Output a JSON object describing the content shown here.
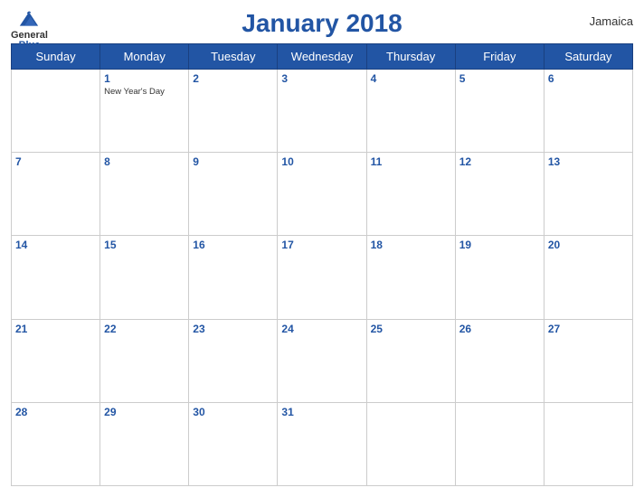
{
  "header": {
    "title": "January 2018",
    "country": "Jamaica",
    "logo": {
      "line1": "General",
      "line2": "Blue"
    }
  },
  "days_of_week": [
    "Sunday",
    "Monday",
    "Tuesday",
    "Wednesday",
    "Thursday",
    "Friday",
    "Saturday"
  ],
  "weeks": [
    [
      {
        "day": "",
        "holiday": ""
      },
      {
        "day": "1",
        "holiday": "New Year's Day"
      },
      {
        "day": "2",
        "holiday": ""
      },
      {
        "day": "3",
        "holiday": ""
      },
      {
        "day": "4",
        "holiday": ""
      },
      {
        "day": "5",
        "holiday": ""
      },
      {
        "day": "6",
        "holiday": ""
      }
    ],
    [
      {
        "day": "7",
        "holiday": ""
      },
      {
        "day": "8",
        "holiday": ""
      },
      {
        "day": "9",
        "holiday": ""
      },
      {
        "day": "10",
        "holiday": ""
      },
      {
        "day": "11",
        "holiday": ""
      },
      {
        "day": "12",
        "holiday": ""
      },
      {
        "day": "13",
        "holiday": ""
      }
    ],
    [
      {
        "day": "14",
        "holiday": ""
      },
      {
        "day": "15",
        "holiday": ""
      },
      {
        "day": "16",
        "holiday": ""
      },
      {
        "day": "17",
        "holiday": ""
      },
      {
        "day": "18",
        "holiday": ""
      },
      {
        "day": "19",
        "holiday": ""
      },
      {
        "day": "20",
        "holiday": ""
      }
    ],
    [
      {
        "day": "21",
        "holiday": ""
      },
      {
        "day": "22",
        "holiday": ""
      },
      {
        "day": "23",
        "holiday": ""
      },
      {
        "day": "24",
        "holiday": ""
      },
      {
        "day": "25",
        "holiday": ""
      },
      {
        "day": "26",
        "holiday": ""
      },
      {
        "day": "27",
        "holiday": ""
      }
    ],
    [
      {
        "day": "28",
        "holiday": ""
      },
      {
        "day": "29",
        "holiday": ""
      },
      {
        "day": "30",
        "holiday": ""
      },
      {
        "day": "31",
        "holiday": ""
      },
      {
        "day": "",
        "holiday": ""
      },
      {
        "day": "",
        "holiday": ""
      },
      {
        "day": "",
        "holiday": ""
      }
    ]
  ],
  "colors": {
    "header_bg": "#2255a4",
    "header_text": "#ffffff",
    "title_color": "#2255a4",
    "day_number_color": "#2255a4"
  }
}
